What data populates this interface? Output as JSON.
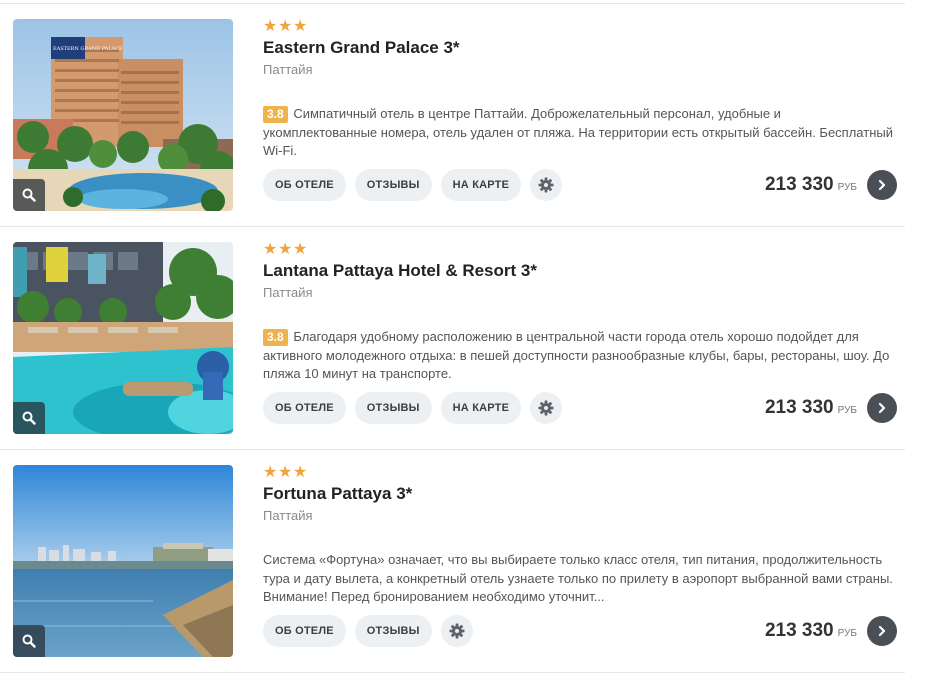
{
  "hotels": [
    {
      "stars": [
        "★",
        "★",
        "★"
      ],
      "name": "Eastern Grand Palace 3*",
      "city": "Паттайя",
      "rating": "3.8",
      "description": "Симпатичный отель в центре Паттайи. Доброжелательный персонал, удобные и укомплектованные номера, отель удален от пляжа. На территории есть открытый бассейн. Бесплатный Wi-Fi.",
      "buttons": {
        "about": "ОБ ОТЕЛЕ",
        "reviews": "ОТЗЫВЫ",
        "map": "НА КАРТЕ"
      },
      "price": "213 330",
      "currency": "РУБ",
      "photo_sign": "EASTERN GRAND PALACE"
    },
    {
      "stars": [
        "★",
        "★",
        "★"
      ],
      "name": "Lantana Pattaya Hotel & Resort 3*",
      "city": "Паттайя",
      "rating": "3.8",
      "description": "Благодаря удобному расположению в центральной части города отель хорошо подойдет для активного молодежного отдыха: в пешей доступности разнообразные клубы, бары, рестораны, шоу. До пляжа 10 минут на транспорте.",
      "buttons": {
        "about": "ОБ ОТЕЛЕ",
        "reviews": "ОТЗЫВЫ",
        "map": "НА КАРТЕ"
      },
      "price": "213 330",
      "currency": "РУБ"
    },
    {
      "stars": [
        "★",
        "★",
        "★"
      ],
      "name": "Fortuna Pattaya 3*",
      "city": "Паттайя",
      "description": "Система «Фортуна» означает, что вы выбираете только класс отеля, тип питания, продолжительность тура и дату вылета, а конкретный отель узнаете только по прилету в аэропорт выбранной вами страны. Внимание! Перед бронированием необходимо уточнит...",
      "buttons": {
        "about": "ОБ ОТЕЛЕ",
        "reviews": "ОТЗЫВЫ"
      },
      "price": "213 330",
      "currency": "РУБ"
    }
  ],
  "icons": {
    "zoom": "search-icon",
    "settings": "gear-icon",
    "go": "chevron-right-icon"
  },
  "colors": {
    "star": "#f0a43b",
    "rating_badge": "#f0b24a",
    "pill_bg": "#edf0f3",
    "go_button": "#4a4f55"
  }
}
